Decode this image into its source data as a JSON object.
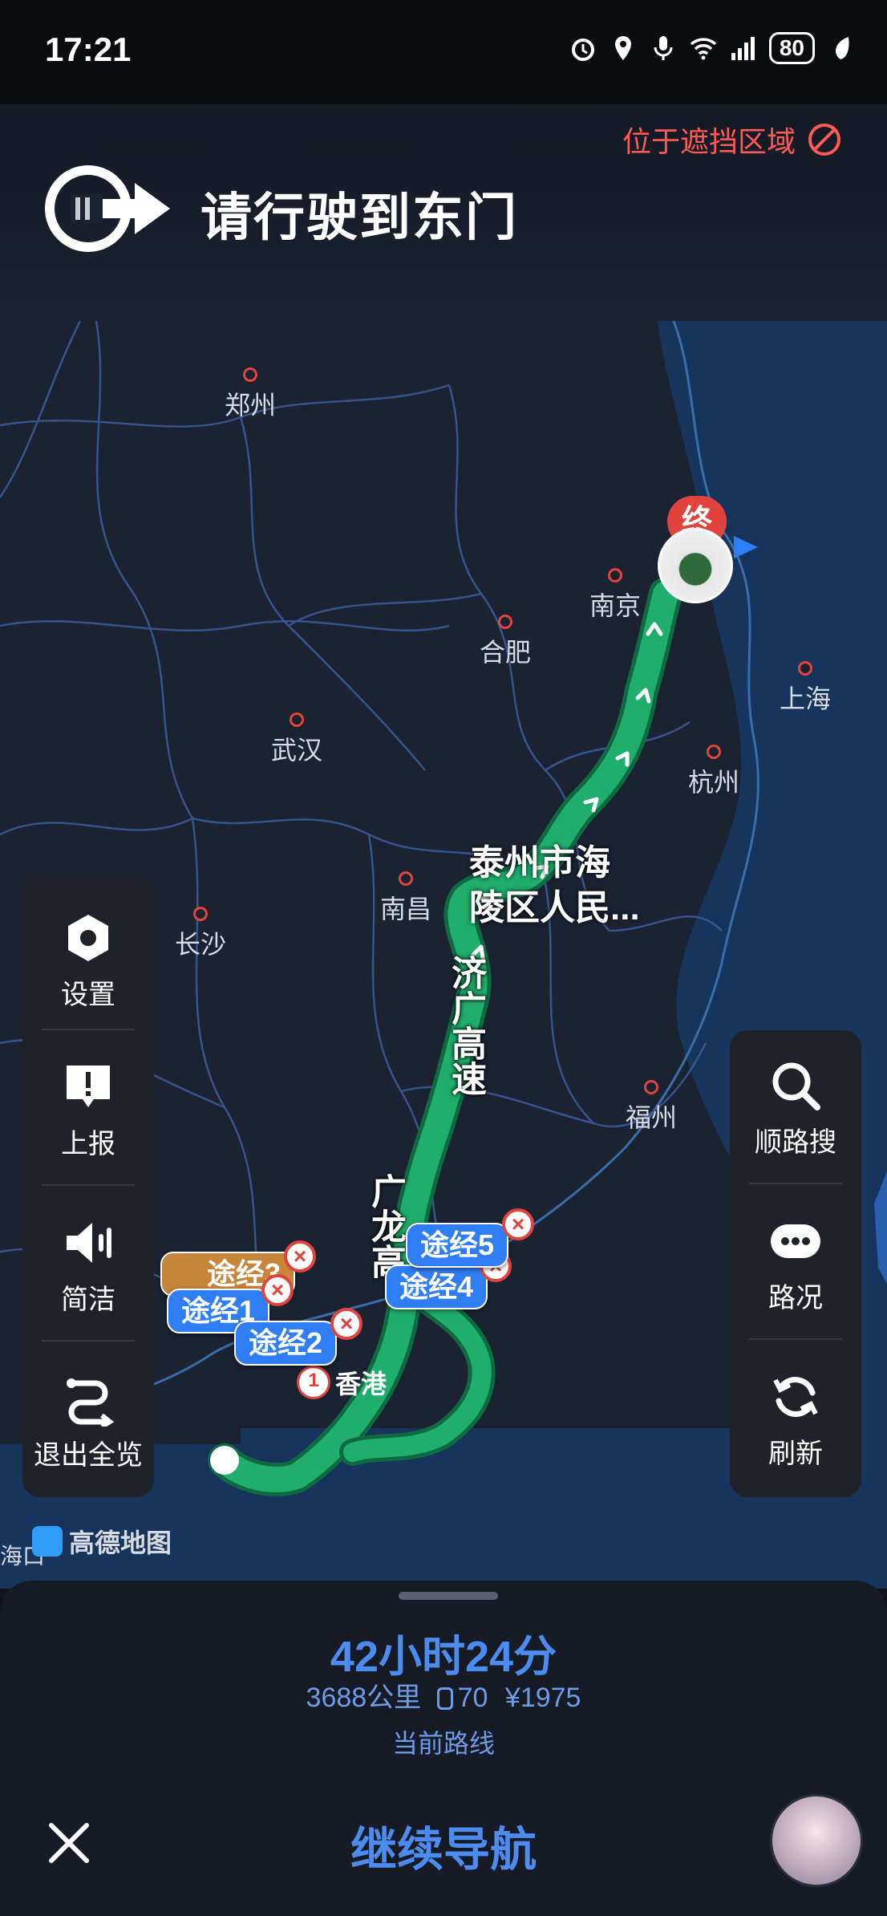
{
  "status_bar": {
    "time": "17:21",
    "battery": "80"
  },
  "header": {
    "warning": "位于遮挡区域",
    "instruction": "请行驶到东门"
  },
  "map": {
    "cities": [
      "郑州",
      "南京",
      "合肥",
      "上海",
      "武汉",
      "杭州",
      "南昌",
      "长沙",
      "福州",
      "香港"
    ],
    "destination_label_line1": "泰州市海",
    "destination_label_line2": "陵区人民...",
    "destination_badge": "终",
    "road_labels": [
      "济广高速",
      "广龙高"
    ],
    "waypoints": [
      "途经1",
      "途经2",
      "途经3",
      "途经4",
      "途经5"
    ],
    "start_marker": "1",
    "attribution": "高德地图",
    "edge_city": "海口"
  },
  "left_panel": [
    {
      "label": "设置",
      "icon": "settings-hex-icon"
    },
    {
      "label": "上报",
      "icon": "report-exclamation-icon"
    },
    {
      "label": "简洁",
      "icon": "speaker-icon"
    },
    {
      "label": "退出全览",
      "icon": "exit-overview-icon"
    }
  ],
  "right_panel": [
    {
      "label": "顺路搜",
      "icon": "search-icon"
    },
    {
      "label": "路况",
      "icon": "traffic-dots-icon"
    },
    {
      "label": "刷新",
      "icon": "refresh-icon"
    }
  ],
  "bottom": {
    "eta": "42小时24分",
    "distance": "3688公里",
    "traffic_lights": "70",
    "toll": "¥1975",
    "route_name": "当前路线",
    "continue_label": "继续导航"
  },
  "colors": {
    "route": "#1fae6b",
    "accent": "#4c8cf0",
    "warning": "#ff5a55"
  }
}
